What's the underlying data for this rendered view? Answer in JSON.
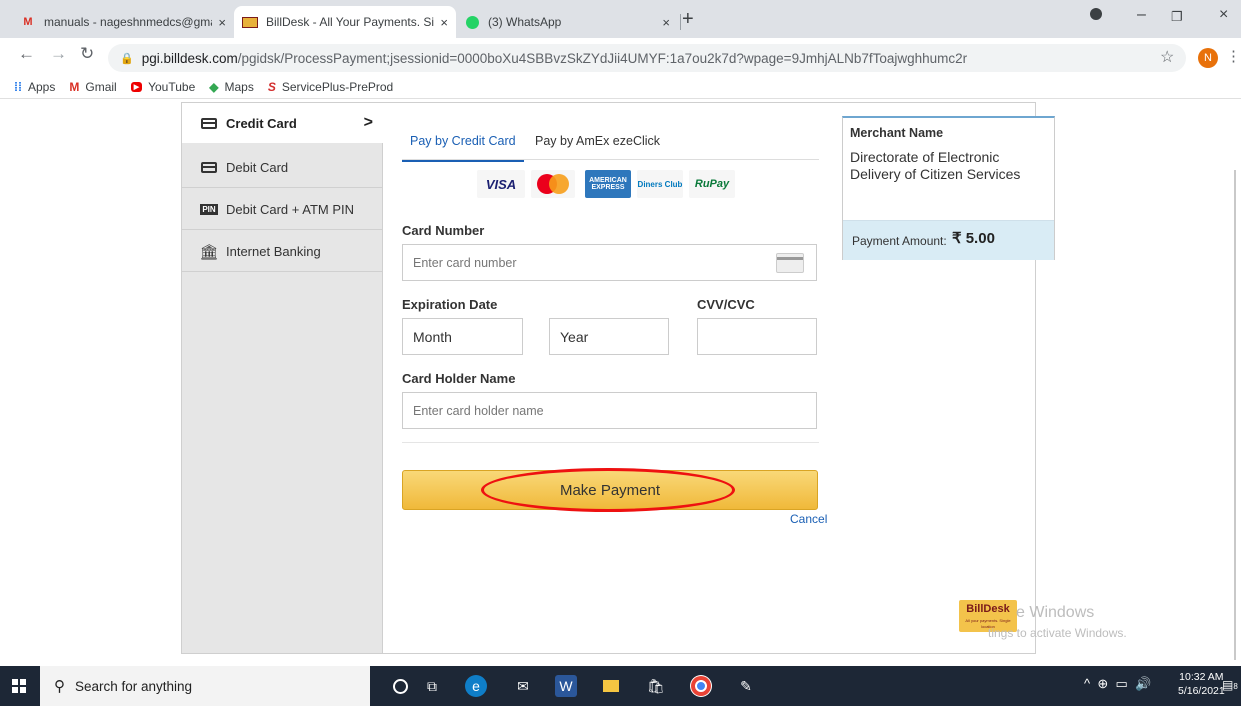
{
  "browser": {
    "tabs": [
      {
        "title": "manuals - nageshnmedcs@gmail",
        "close": "×"
      },
      {
        "title": "BillDesk - All Your Payments. Sing",
        "close": "×"
      },
      {
        "title": "(3) WhatsApp",
        "close": "×"
      }
    ],
    "new_tab": "+",
    "url_host": "pgi.billdesk.com",
    "url_path": "/pgidsk/ProcessPayment;jsessionid=0000boXu4SBBvzSkZYdJii4UMYF:1a7ou2k7d?wpage=9JmhjALNb7fToajwghhumc2r",
    "profile_initial": "N",
    "bookmarks": [
      "Apps",
      "Gmail",
      "YouTube",
      "Maps",
      "ServicePlus-PreProd"
    ]
  },
  "payment_menu": {
    "items": [
      {
        "label": "Credit Card",
        "active": true
      },
      {
        "label": "Debit Card",
        "active": false
      },
      {
        "label": "Debit Card + ATM PIN",
        "active": false
      },
      {
        "label": "Internet Banking",
        "active": false
      }
    ],
    "pin_badge": "PIN"
  },
  "form": {
    "tabs": [
      "Pay by Credit Card",
      "Pay by AmEx ezeClick"
    ],
    "logos": {
      "visa": "VISA",
      "amex": "AMERICAN EXPRESS",
      "diners": "Diners Club",
      "rupay": "RuPay"
    },
    "card_number_label": "Card Number",
    "card_number_placeholder": "Enter card number",
    "expiration_label": "Expiration Date",
    "month": "Month",
    "year": "Year",
    "cvv_label": "CVV/CVC",
    "holder_label": "Card Holder Name",
    "holder_placeholder": "Enter card holder name",
    "pay_button": "Make Payment",
    "cancel": "Cancel"
  },
  "merchant": {
    "title": "Merchant Name",
    "name": "Directorate of Electronic Delivery of Citizen Services",
    "amount_label": "Payment Amount:",
    "amount": "₹ 5.00"
  },
  "watermark": {
    "logo": "BillDesk",
    "logo_tagline": "All your payments. Single location",
    "line1": "e Windows",
    "line2": "tings to activate Windows."
  },
  "taskbar": {
    "search_placeholder": "Search for anything",
    "time": "10:32 AM",
    "date": "5/16/2021",
    "notification_count": "8"
  },
  "colors": {
    "accent": "#1a5fb4",
    "pay_button": "#f0b93a",
    "highlight": "#e11111",
    "amount_bg": "#d9ecf5"
  }
}
